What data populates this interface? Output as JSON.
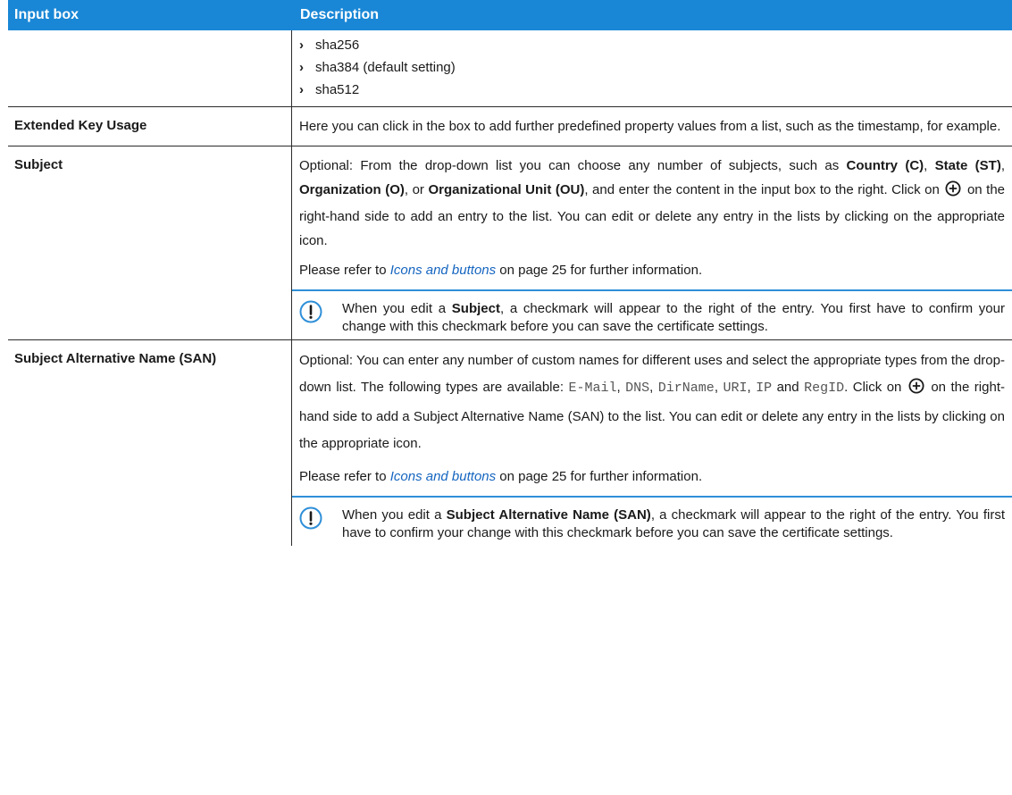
{
  "header": {
    "col1": "Input box",
    "col2": "Description"
  },
  "hash_row": {
    "bullets": [
      "sha256",
      "sha384 (default setting)",
      "sha512"
    ]
  },
  "eku_row": {
    "label": "Extended Key Usage",
    "text": "Here you can click in the box to add further predefined property values from a list, such as the timestamp, for example."
  },
  "subject_row": {
    "label": "Subject",
    "p1_a": "Optional: From the drop-down list you can choose any number of subjects, such as ",
    "b1": "Country (C)",
    "s1": ", ",
    "b2": "State (ST)",
    "s2": ", ",
    "b3": "Organization (O)",
    "s3": ", or ",
    "b4": "Organizational Unit (OU)",
    "p1_b": ", and enter the content in the input box to the right. Click on ",
    "p1_c": " on the right-hand side to add an entry to the list. You can edit or delete any entry in the lists by clicking on the appropriate icon.",
    "ref_a": "Please refer to ",
    "ref_link": "Icons and buttons",
    "ref_b": " on page 25 for further information.",
    "note_a": "When you edit a ",
    "note_b": "Subject",
    "note_c": ", a checkmark will appear to the right of the entry. You first have to confirm your change with this checkmark before you can save the certificate settings."
  },
  "san_row": {
    "label": "Subject Alternative Name (SAN)",
    "p1_a": "Optional: You can enter any number of custom names for different uses and select the appropriate types from the drop-down list. The following types are available: ",
    "t1": "E-Mail",
    "s1": ", ",
    "t2": "DNS",
    "s2": ", ",
    "t3": "DirName",
    "s3": ", ",
    "t4": "URI",
    "s4": ", ",
    "t5": "IP",
    "s5": " and ",
    "t6": "RegID",
    "p1_b": ". Click on ",
    "p1_c": " on the right-hand side to add a Subject Alternative Name (SAN) to the list. You can edit or delete any entry in the lists by clicking on the appropriate icon.",
    "ref_a": "Please refer to ",
    "ref_link": "Icons and buttons",
    "ref_b": " on page 25 for further information.",
    "note_a": "When you edit a ",
    "note_b": "Subject Alternative Name (SAN)",
    "note_c": ", a checkmark will appear to the right of the entry. You first have to confirm your change with this checkmark before you can save the certificate settings."
  },
  "colors": {
    "header_bg": "#1a87d6",
    "note_accent": "#2f8fd8",
    "link": "#1565c0"
  },
  "icons": [
    "chevron-right-icon",
    "plus-circle-icon",
    "exclamation-circle-icon"
  ]
}
